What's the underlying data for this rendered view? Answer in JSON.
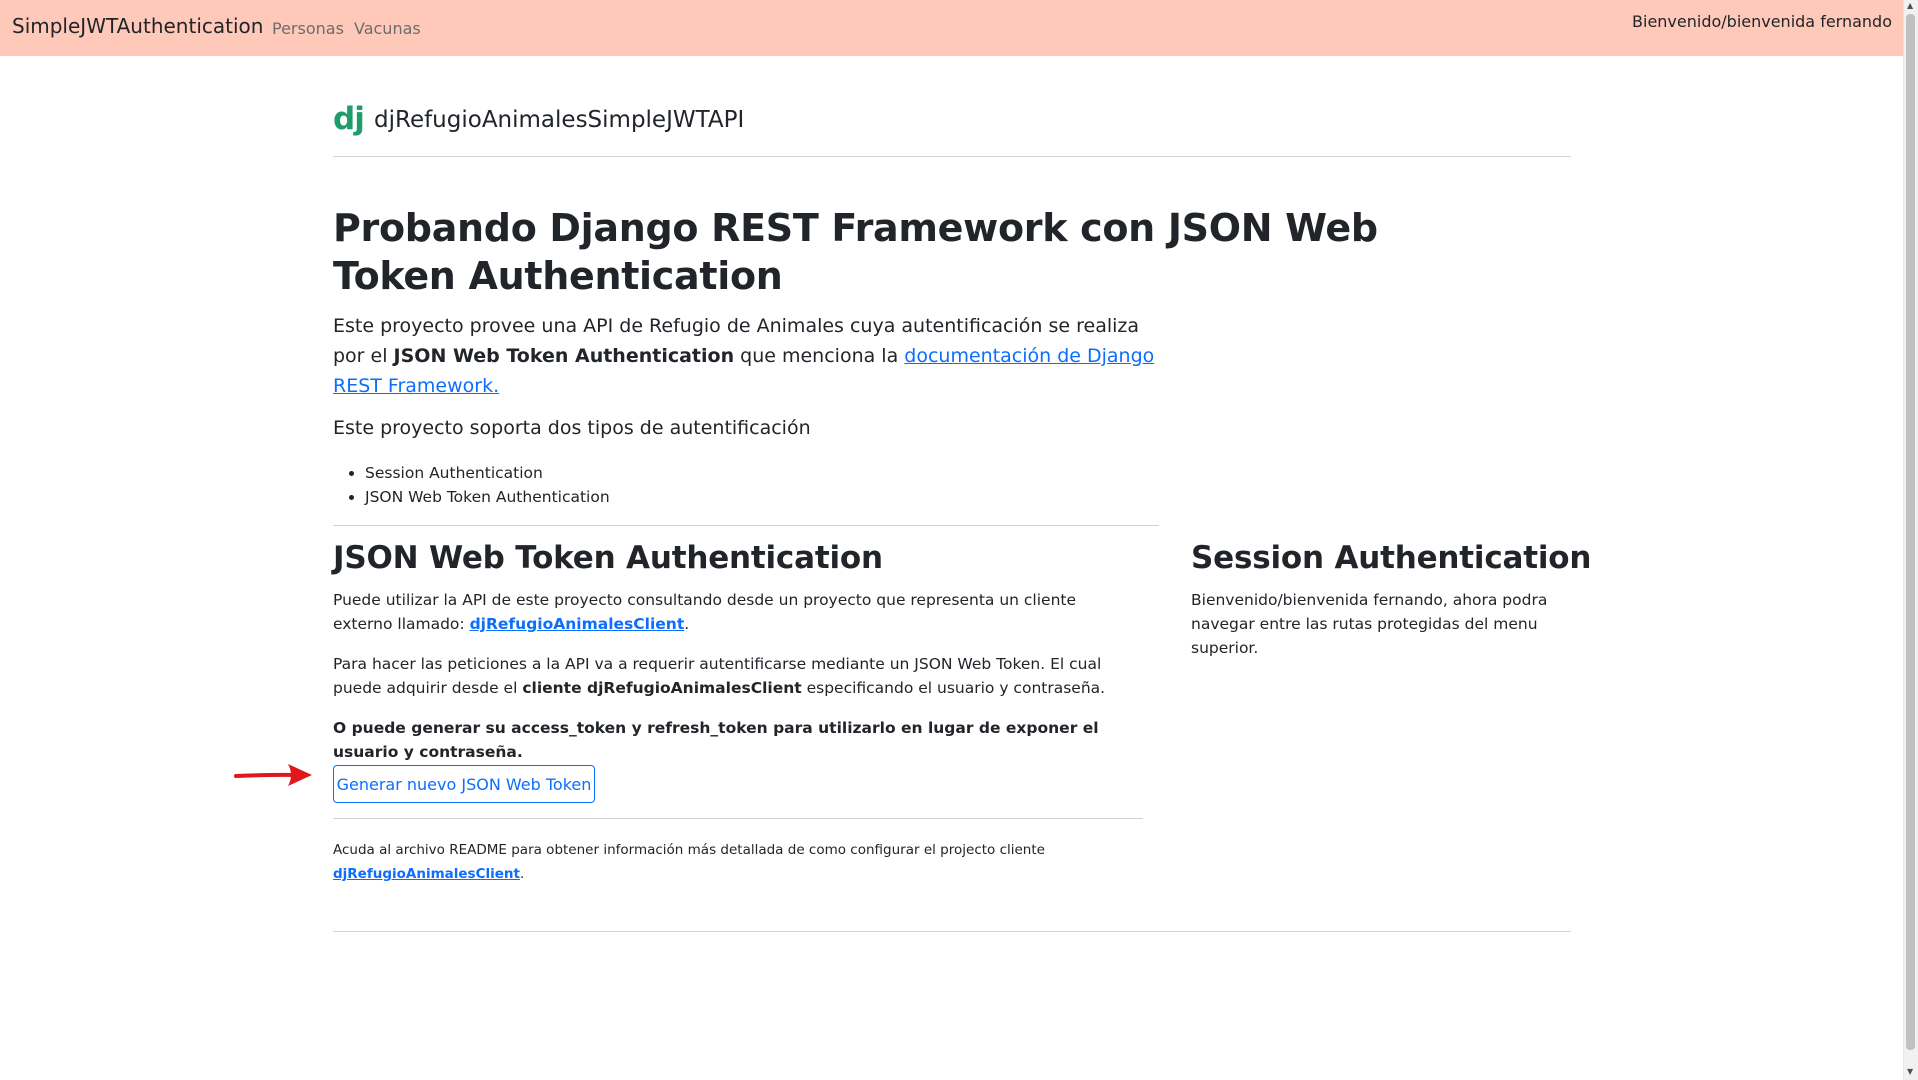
{
  "navbar": {
    "brand": "SimpleJWTAuthentication",
    "links": [
      "Personas",
      "Vacunas"
    ],
    "welcome": "Bienvenido/bienvenida fernando",
    "background_color": "#ffc9b9"
  },
  "header": {
    "logo_text": "dj",
    "logo_color": "#1e9c6c",
    "title": "djRefugioAnimalesSimpleJWTAPI"
  },
  "main": {
    "heading": "Probando Django REST Framework con JSON Web Token Authentication",
    "intro": {
      "text_before": "Este proyecto provee una API de Refugio de Animales cuya autentificación se realiza por el ",
      "bold": "JSON Web Token Authentication",
      "text_middle": " que menciona la ",
      "link": "documentación de Django REST Framework."
    },
    "auth_types_intro": "Este proyecto soporta dos tipos de autentificación",
    "auth_types": [
      "Session Authentication",
      "JSON Web Token Authentication"
    ]
  },
  "jwt_section": {
    "heading": "JSON Web Token Authentication",
    "para1": {
      "text": "Puede utilizar la API de este proyecto consultando desde un proyecto que representa un cliente externo llamado: ",
      "link": "djRefugioAnimalesClient",
      "after": "."
    },
    "para2": {
      "text": "Para hacer las peticiones a la API va a requerir autentificarse mediante un JSON Web Token. El cual puede adquirir desde el ",
      "bold": "cliente djRefugioAnimalesClient",
      "after": " especificando el usuario y contraseña."
    },
    "para3": "O puede generar su access_token y refresh_token para utilizarlo en lugar de exponer el usuario y contraseña.",
    "button_label": "Generar nuevo JSON Web Token",
    "readme": {
      "text": "Acuda al archivo README para obtener información más detallada de como configurar el projecto cliente ",
      "link": "djRefugioAnimalesClient",
      "after": "."
    }
  },
  "session_section": {
    "heading": "Session Authentication",
    "text": "Bienvenido/bienvenida fernando, ahora podra navegar entre las rutas protegidas del menu superior."
  },
  "colors": {
    "link": "#0d6efd",
    "annotation_arrow": "#e0181b"
  }
}
